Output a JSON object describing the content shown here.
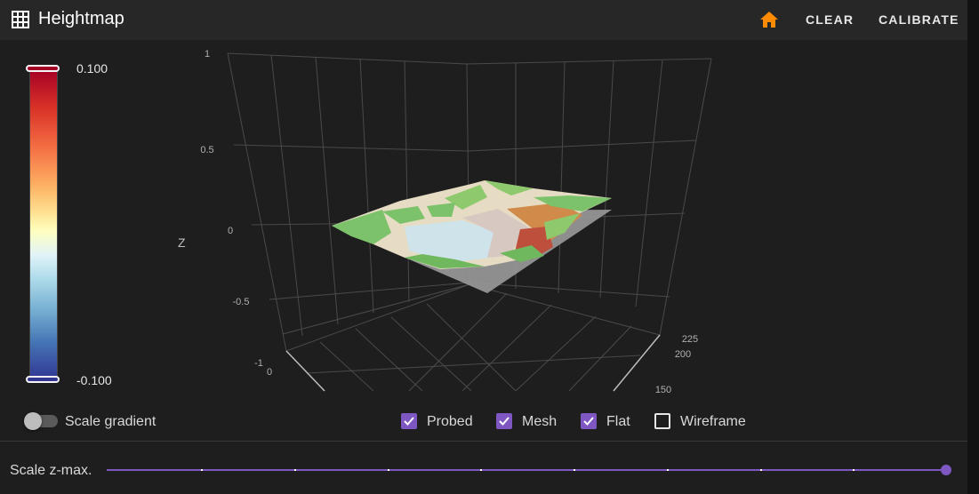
{
  "header": {
    "title": "Heightmap",
    "clear_label": "CLEAR",
    "calibrate_label": "CALIBRATE",
    "title_icon": "grid-icon",
    "home_icon": "home-icon"
  },
  "colors": {
    "accent": "#7e57c2",
    "home": "#ff8c00",
    "header_bg": "#272727",
    "page_bg": "#1e1e1e"
  },
  "colorscale": {
    "max_label": "0.100",
    "min_label": "-0.100"
  },
  "plot": {
    "z_title": "Z",
    "z_ticks": [
      "1",
      "0.5",
      "0",
      "-0.5",
      "-1"
    ],
    "x_ticks": [
      "0"
    ],
    "y_ticks": [
      "225",
      "200",
      "150"
    ]
  },
  "scale_gradient": {
    "label": "Scale gradient",
    "enabled": false
  },
  "checkboxes": [
    {
      "label": "Probed",
      "checked": true
    },
    {
      "label": "Mesh",
      "checked": true
    },
    {
      "label": "Flat",
      "checked": true
    },
    {
      "label": "Wireframe",
      "checked": false
    }
  ],
  "scale_zmax": {
    "label": "Scale z-max.",
    "value": 1.0
  }
}
